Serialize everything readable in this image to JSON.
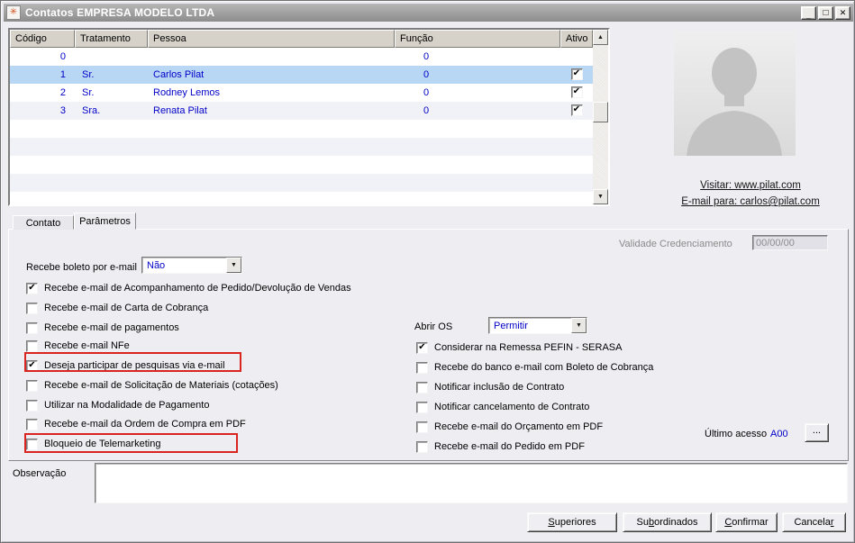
{
  "window": {
    "title": "Contatos EMPRESA MODELO LTDA",
    "icon_glyph": "✳",
    "controls": {
      "minimize": "_",
      "maximize": "□",
      "close": "✕"
    }
  },
  "colors": {
    "accent_blue": "#0000C8",
    "selection_blue": "#B8D7F5",
    "annotation_red": "#DA241F",
    "titlebar_gray": "#9C9C9C",
    "dialog_bg": "#EEEDF2"
  },
  "contacts_table": {
    "columns": [
      "Código",
      "Tratamento",
      "Pessoa",
      "Função",
      "Ativo"
    ],
    "rows": [
      {
        "codigo": "0",
        "tratamento": "",
        "pessoa": "",
        "funcao": "0",
        "ativo": false,
        "selected": false
      },
      {
        "codigo": "1",
        "tratamento": "Sr.",
        "pessoa": "Carlos Pilat",
        "funcao": "0",
        "ativo": true,
        "selected": true
      },
      {
        "codigo": "2",
        "tratamento": "Sr.",
        "pessoa": "Rodney Lemos",
        "funcao": "0",
        "ativo": true,
        "selected": false
      },
      {
        "codigo": "3",
        "tratamento": "Sra.",
        "pessoa": "Renata Pilat",
        "funcao": "0",
        "ativo": true,
        "selected": false
      }
    ]
  },
  "contact_card": {
    "visit_link": "Visitar: www.pilat.com",
    "email_link": "E-mail para: carlos@pilat.com"
  },
  "tabs": [
    {
      "label": "Contato",
      "active": false
    },
    {
      "label": "Parâmetros",
      "active": true
    }
  ],
  "parameters": {
    "validade_label": "Validade Credenciamento",
    "validade_value": "00/00/00",
    "boleto_label": "Recebe boleto por e-mail",
    "boleto_value": "Não",
    "abrir_os_label": "Abrir OS",
    "abrir_os_value": "Permitir",
    "left_checkboxes": [
      {
        "label": "Recebe e-mail de Acompanhamento de Pedido/Devolução de Vendas",
        "checked": true,
        "highlighted": false
      },
      {
        "label": "Recebe e-mail de Carta de Cobrança",
        "checked": false,
        "highlighted": false
      },
      {
        "label": "Recebe e-mail de pagamentos",
        "checked": false,
        "highlighted": false
      },
      {
        "label": "Recebe e-mail NFe",
        "checked": false,
        "highlighted": false
      },
      {
        "label": "Deseja participar de pesquisas via e-mail",
        "checked": true,
        "highlighted": true
      },
      {
        "label": "Recebe e-mail de Solicitação de Materiais (cotações)",
        "checked": false,
        "highlighted": false
      },
      {
        "label": "Utilizar na Modalidade de Pagamento",
        "checked": false,
        "highlighted": false
      },
      {
        "label": "Recebe e-mail da Ordem de Compra em PDF",
        "checked": false,
        "highlighted": false
      },
      {
        "label": "Bloqueio de Telemarketing",
        "checked": false,
        "highlighted": true
      }
    ],
    "right_checkboxes": [
      {
        "label": "Considerar na Remessa PEFIN - SERASA",
        "checked": true
      },
      {
        "label": "Recebe do banco e-mail com Boleto de Cobrança",
        "checked": false
      },
      {
        "label": "Notificar inclusão de Contrato",
        "checked": false
      },
      {
        "label": "Notificar cancelamento de Contrato",
        "checked": false
      },
      {
        "label": "Recebe e-mail do Orçamento em PDF",
        "checked": false
      },
      {
        "label": "Recebe e-mail do Pedido em PDF",
        "checked": false
      }
    ],
    "ultimo_acesso_label": "Último acesso",
    "ultimo_acesso_value": "A00",
    "more_button_label": "..."
  },
  "observacao": {
    "label": "Observação",
    "value": ""
  },
  "footer_buttons": {
    "superiores": {
      "pre": "",
      "key": "S",
      "post": "uperiores"
    },
    "subordinados": {
      "pre": "Su",
      "key": "b",
      "post": "ordinados"
    },
    "confirmar": {
      "pre": "",
      "key": "C",
      "post": "onfirmar"
    },
    "cancelar": {
      "pre": "Cancela",
      "key": "r",
      "post": ""
    }
  },
  "icons": {
    "scroll_up": "▲",
    "scroll_down": "▼",
    "dropdown": "▼",
    "check": "✔"
  }
}
